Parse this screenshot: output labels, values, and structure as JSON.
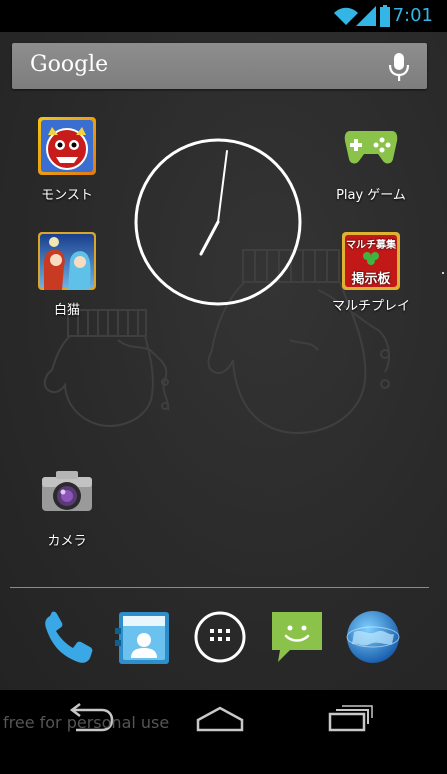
{
  "status_bar": {
    "time": "7:01",
    "icons": [
      "wifi-icon",
      "signal-icon",
      "battery-icon"
    ],
    "accent_color": "#33b5e5"
  },
  "search": {
    "label": "Google",
    "voice_icon": "mic-icon"
  },
  "home_apps": [
    {
      "name": "モンスト",
      "icon": "monst-app-icon"
    },
    {
      "name": "Play ゲーム",
      "icon": "play-games-icon"
    },
    {
      "name": "白猫",
      "icon": "shironeko-app-icon"
    },
    {
      "name": "マルチプレイ",
      "icon": "multiplay-board-icon"
    },
    {
      "name": "カメラ",
      "icon": "camera-icon"
    }
  ],
  "multiplay_icon_text": {
    "line1": "マルチ募集",
    "line2": "掲示板"
  },
  "dock": [
    {
      "name": "phone",
      "icon": "phone-icon"
    },
    {
      "name": "contacts",
      "icon": "contacts-icon"
    },
    {
      "name": "app drawer",
      "icon": "app-drawer-icon"
    },
    {
      "name": "messaging",
      "icon": "messaging-icon"
    },
    {
      "name": "browser",
      "icon": "browser-globe-icon"
    }
  ],
  "clock_widget": {
    "hour": 7,
    "minute": 1
  },
  "nav_bar": {
    "buttons": [
      "back-icon",
      "home-icon",
      "recents-icon"
    ]
  },
  "watermark": "free for personal use"
}
